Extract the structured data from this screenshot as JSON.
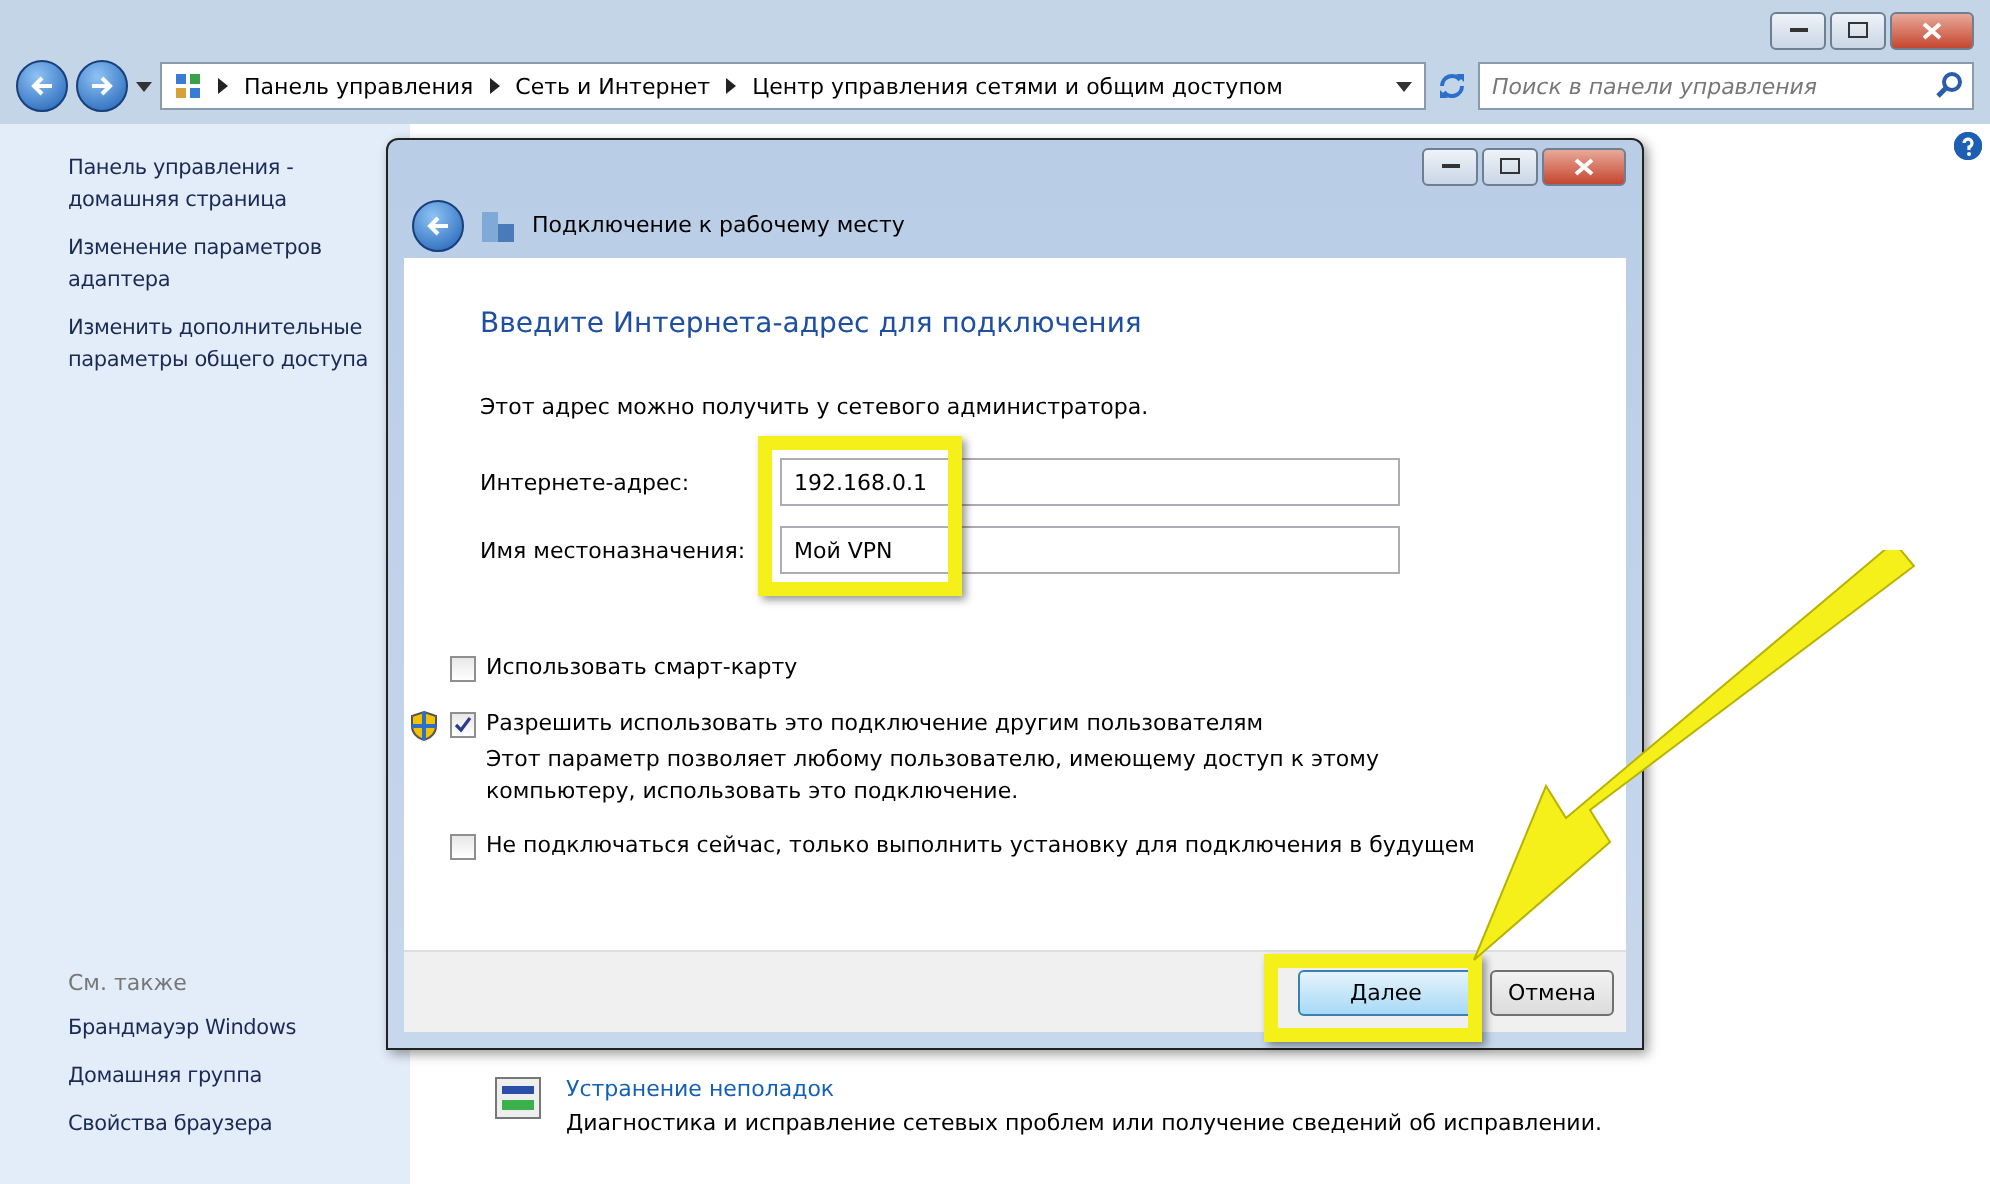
{
  "window": {
    "breadcrumbs": [
      "Панель управления",
      "Сеть и Интернет",
      "Центр управления сетями и общим доступом"
    ],
    "search": {
      "placeholder": "Поиск в панели управления"
    }
  },
  "sidebar": {
    "links": [
      "Панель управления - домашняя страница",
      "Изменение параметров адаптера",
      "Изменить дополнительные параметры общего доступа"
    ],
    "see_also_heading": "См. также",
    "see_also": [
      "Брандмауэр Windows",
      "Домашняя группа",
      "Свойства браузера"
    ]
  },
  "main": {
    "troubleshoot": {
      "link": "Устранение неполадок",
      "description": "Диагностика и исправление сетевых проблем или получение сведений об исправлении."
    }
  },
  "dialog": {
    "title": "Подключение к рабочему месту",
    "heading": "Введите Интернета-адрес для подключения",
    "intro": "Этот адрес можно получить у сетевого администратора.",
    "fields": [
      {
        "label": "Интернете-адрес:",
        "value": "192.168.0.1"
      },
      {
        "label": "Имя местоназначения:",
        "value": "Мой VPN"
      }
    ],
    "options": [
      {
        "label": "Использовать смарт-карту",
        "checked": false,
        "shield": false
      },
      {
        "label": "Разрешить использовать это подключение другим пользователям",
        "checked": true,
        "shield": true,
        "note": "Этот параметр позволяет любому пользователю, имеющему доступ к этому компьютеру, использовать это подключение."
      },
      {
        "label": "Не подключаться сейчас, только выполнить установку для подключения в будущем",
        "checked": false,
        "shield": false
      }
    ],
    "buttons": [
      {
        "label": "Далее",
        "selected": true
      },
      {
        "label": "Отмена",
        "selected": false
      }
    ]
  }
}
